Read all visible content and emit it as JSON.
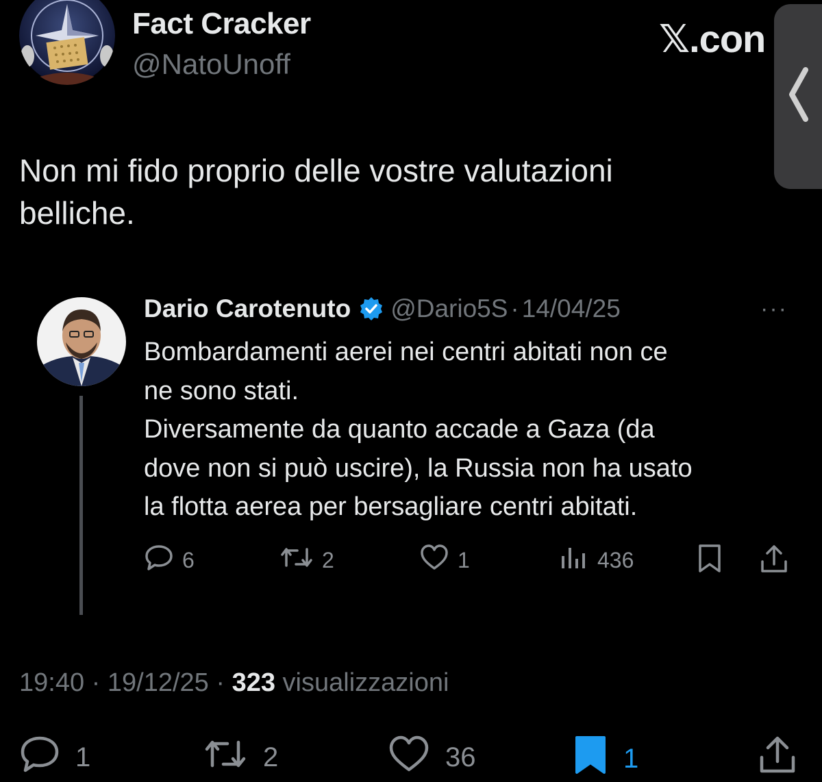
{
  "browser": {
    "site_label": "𝕏.con"
  },
  "tweet": {
    "author_name": "Fact Cracker",
    "author_handle": "@NatoUnoff",
    "text": "Non mi fido proprio delle vostre valutazioni\nbelliche.",
    "time": "19:40",
    "date": "19/12/25",
    "separator": "·",
    "views": "323",
    "views_label": "visualizzazioni",
    "actions": {
      "replies": "1",
      "reposts": "2",
      "likes": "36",
      "bookmarks": "1"
    }
  },
  "quoted": {
    "author_name": "Dario Carotenuto",
    "author_handle": "@Dario5S",
    "date": "14/04/25",
    "separator": "·",
    "more": "···",
    "text": "Bombardamenti aerei nei centri abitati non ce\nne sono stati.\nDiversamente da quanto accade a Gaza (da\ndove non si può uscire), la Russia non ha usato\nla flotta aerea per bersagliare centri abitati.",
    "actions": {
      "replies": "6",
      "reposts": "2",
      "likes": "1",
      "views": "436"
    }
  },
  "colors": {
    "background": "#000000",
    "text": "#e7e9ea",
    "muted": "#71767b",
    "accent": "#1d9bf0"
  },
  "icons": [
    "reply-icon",
    "repost-icon",
    "like-icon",
    "views-icon",
    "bookmark-icon",
    "share-icon",
    "verified-badge-icon",
    "more-icon",
    "chevron-left-icon"
  ]
}
